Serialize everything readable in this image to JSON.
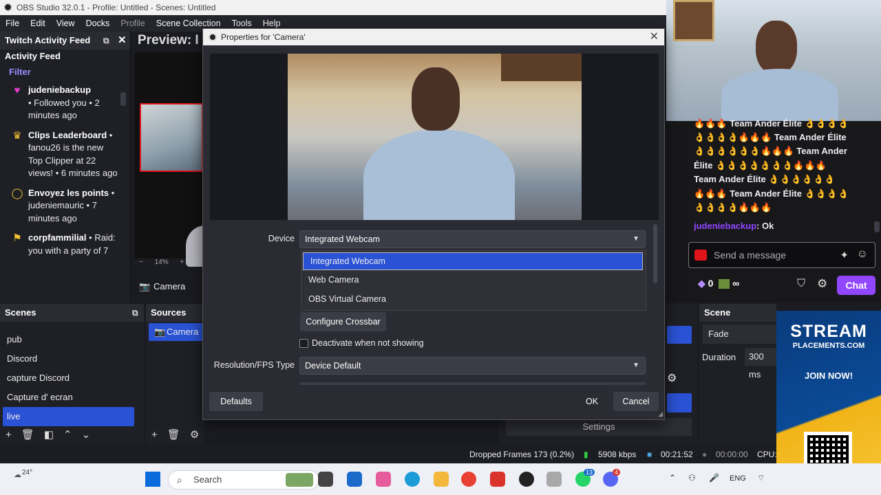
{
  "window": {
    "title": "OBS Studio 32.0.1 - Profile: Untitled - Scenes: Untitled"
  },
  "menu": [
    "File",
    "Edit",
    "View",
    "Docks",
    "Profile",
    "Scene Collection",
    "Tools",
    "Help"
  ],
  "feed": {
    "dock_title": "Twitch Activity Feed",
    "heading": "Activity Feed",
    "filter": "Filter",
    "items": [
      {
        "name": "judeniebackup",
        "text": "• Followed you • 2 minutes ago"
      },
      {
        "name": "Clips Leaderboard",
        "text": "• fanou26 is the new Top Clipper at 22 views! • 6 minutes ago"
      },
      {
        "name": "Envoyez les points",
        "text": "• judeniemauric • 7 minutes ago"
      },
      {
        "name": "corpfammilial",
        "text": "• Raid: you with a party of 7"
      }
    ]
  },
  "preview": {
    "title": "Preview: I",
    "zoom": "14%",
    "source_label": "Camera"
  },
  "scenes": {
    "title": "Scenes",
    "items": [
      "pub",
      "Discord",
      "capture Discord",
      "Capture d' ecran",
      "live"
    ],
    "selected": "live"
  },
  "sources": {
    "title": "Sources",
    "items": [
      "Camera"
    ]
  },
  "dialog": {
    "title": "Properties for 'Camera'",
    "device_label": "Device",
    "device_value": "Integrated Webcam",
    "options": [
      "Integrated Webcam",
      "Web Camera",
      "OBS Virtual Camera"
    ],
    "configure_button": "Configure Crossbar",
    "deactivate_label": "Deactivate when not showing",
    "resolution_label": "Resolution/FPS Type",
    "resolution_value": "Device Default",
    "defaults_button": "Defaults",
    "ok_button": "OK",
    "cancel_button": "Cancel"
  },
  "controls": {
    "settings_button": "Settings"
  },
  "transitions": {
    "title": "Scene Transitions",
    "value": "Fade",
    "duration_label": "Duration",
    "duration_value": "300 ms"
  },
  "status": {
    "dropped": "Dropped Frames 173 (0.2%)",
    "bitrate": "5908 kbps",
    "rec_time": "00:21:52",
    "stream_time": "00:00:00",
    "cpu": "CPU:"
  },
  "chat": {
    "lines": [
      "🔥🔥🔥 Team Ander Élite 👌👌👌👌",
      "👌👌👌👌🔥🔥🔥 Team Ander Élite",
      "👌👌👌👌👌👌🔥🔥🔥 Team Ander",
      "Élite 👌👌👌👌👌👌👌🔥🔥🔥",
      "Team Ander Élite 👌👌👌👌👌👌",
      "🔥🔥🔥 Team Ander Élite 👌👌👌👌",
      "👌👌👌👌🔥🔥🔥"
    ],
    "last_user": "judeniebackup",
    "last_msg": ": Ok",
    "input_placeholder": "Send a message",
    "points": "0",
    "infinity": "∞",
    "chat_button": "Chat"
  },
  "ad": {
    "brand": "STREAM",
    "sub": "PLACEMENTS.COM",
    "cta": "JOIN NOW!"
  },
  "taskbar": {
    "temp": "24°",
    "search_placeholder": "Search",
    "lang": "ENG",
    "badge1": "13",
    "badge2": "4"
  },
  "colors": {
    "accent": "#2a52d4",
    "twitch": "#9147ff",
    "preview_border": "#e0151b"
  }
}
